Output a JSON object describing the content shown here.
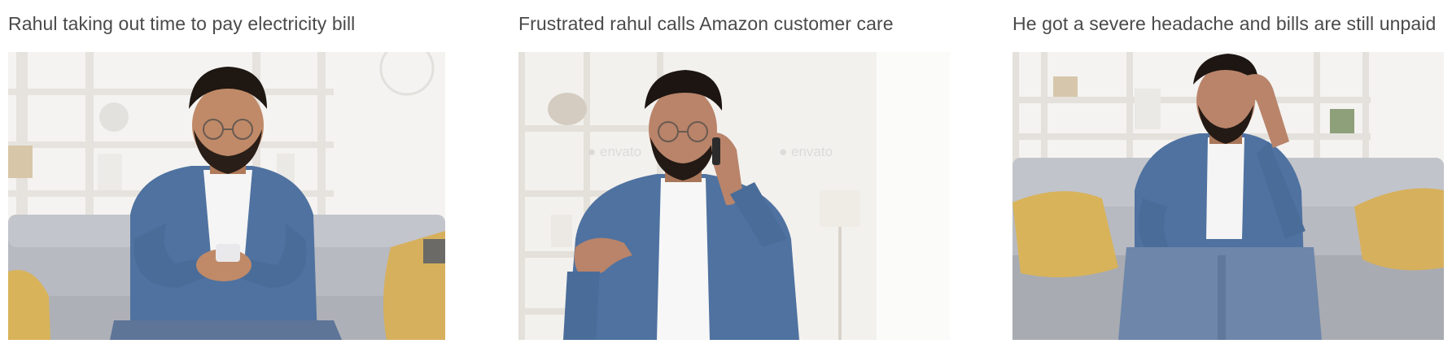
{
  "panels": [
    {
      "caption": "Rahul taking out time to pay electricity bill",
      "scene": "smiling man using phone on sofa"
    },
    {
      "caption": "Frustrated rahul calls Amazon customer care",
      "scene": "frustrated man talking on phone",
      "watermark": "envato"
    },
    {
      "caption": "He got a severe headache and bills are still unpaid",
      "scene": "man holding head with headache on sofa"
    }
  ],
  "colors": {
    "caption_text": "#4a4a4a",
    "denim": "#4f72a0",
    "sofa": "#b9bbc2",
    "pillow": "#d9b45a",
    "wall": "#f3f1ee"
  }
}
